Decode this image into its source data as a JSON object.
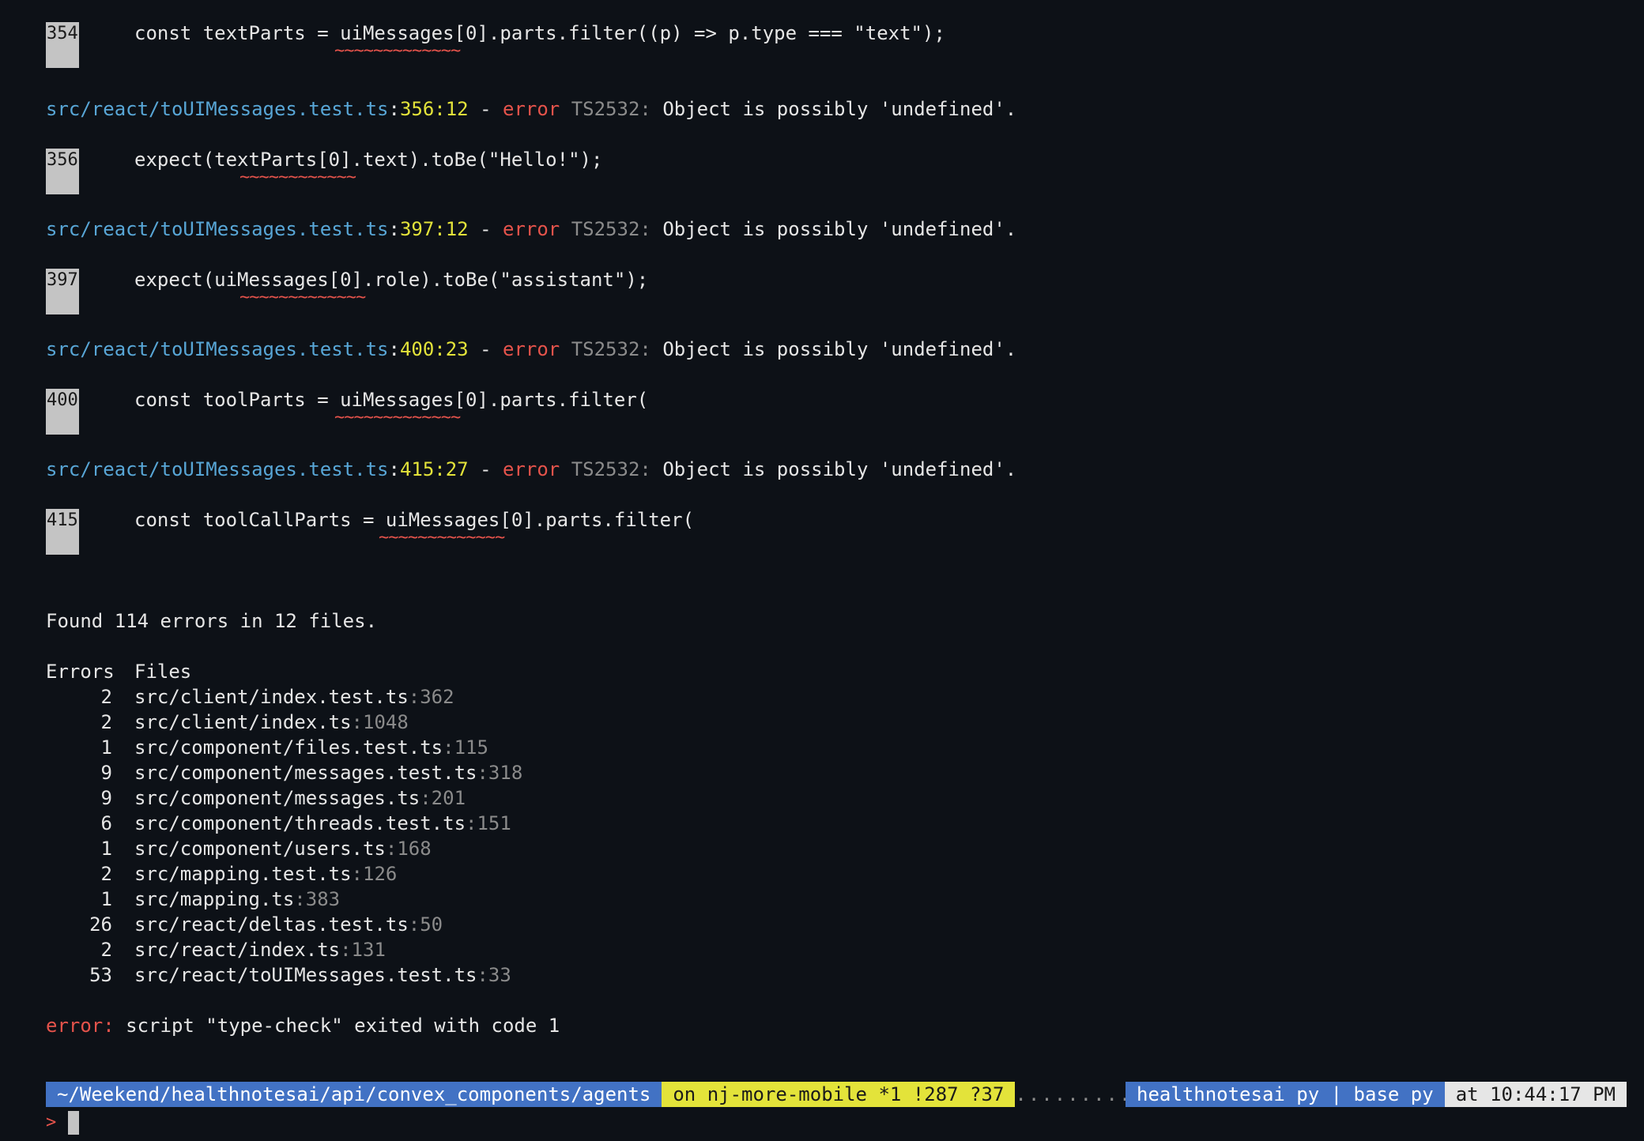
{
  "blocks": [
    {
      "lineno": "354",
      "code": "const textParts = uiMessages[0].parts.filter((p) => p.type === \"text\");",
      "squiggle": "~~~~~~~~~~~~~"
    },
    {
      "header": {
        "path": "src/react/toUIMessages.test.ts",
        "loc": "356:12",
        "dash": " - ",
        "level": "error",
        "code": "TS2532:",
        "message": "Object is possibly 'undefined'."
      },
      "lineno": "356",
      "code": "expect(textParts[0].text).toBe(\"Hello!\");",
      "squiggle": "~~~~~~~~~~~~"
    },
    {
      "header": {
        "path": "src/react/toUIMessages.test.ts",
        "loc": "397:12",
        "dash": " - ",
        "level": "error",
        "code": "TS2532:",
        "message": "Object is possibly 'undefined'."
      },
      "lineno": "397",
      "code": "expect(uiMessages[0].role).toBe(\"assistant\");",
      "squiggle": "~~~~~~~~~~~~~"
    },
    {
      "header": {
        "path": "src/react/toUIMessages.test.ts",
        "loc": "400:23",
        "dash": " - ",
        "level": "error",
        "code": "TS2532:",
        "message": "Object is possibly 'undefined'."
      },
      "lineno": "400",
      "code": "const toolParts = uiMessages[0].parts.filter(",
      "squiggle": "~~~~~~~~~~~~~"
    },
    {
      "header": {
        "path": "src/react/toUIMessages.test.ts",
        "loc": "415:27",
        "dash": " - ",
        "level": "error",
        "code": "TS2532:",
        "message": "Object is possibly 'undefined'."
      },
      "lineno": "415",
      "code": "const toolCallParts = uiMessages[0].parts.filter(",
      "squiggle": "~~~~~~~~~~~~~"
    }
  ],
  "summary": "Found 114 errors in 12 files.",
  "table": {
    "header_errors": "Errors",
    "header_files": "Files",
    "rows": [
      {
        "count": "2",
        "file": "src/client/index.test.ts",
        "line": ":362"
      },
      {
        "count": "2",
        "file": "src/client/index.ts",
        "line": ":1048"
      },
      {
        "count": "1",
        "file": "src/component/files.test.ts",
        "line": ":115"
      },
      {
        "count": "9",
        "file": "src/component/messages.test.ts",
        "line": ":318"
      },
      {
        "count": "9",
        "file": "src/component/messages.ts",
        "line": ":201"
      },
      {
        "count": "6",
        "file": "src/component/threads.test.ts",
        "line": ":151"
      },
      {
        "count": "1",
        "file": "src/component/users.ts",
        "line": ":168"
      },
      {
        "count": "2",
        "file": "src/mapping.test.ts",
        "line": ":126"
      },
      {
        "count": "1",
        "file": "src/mapping.ts",
        "line": ":383"
      },
      {
        "count": "26",
        "file": "src/react/deltas.test.ts",
        "line": ":50"
      },
      {
        "count": "2",
        "file": "src/react/index.ts",
        "line": ":131"
      },
      {
        "count": "53",
        "file": "src/react/toUIMessages.test.ts",
        "line": ":33"
      }
    ]
  },
  "final_error": {
    "label": "error:",
    "message": " script \"type-check\" exited with code 1"
  },
  "prompt": {
    "cwd": "~/Weekend/healthnotesai/api/convex_components/agents",
    "branch": "on nj-more-mobile *1 !287 ?37",
    "dots": "..............................................",
    "env": "healthnotesai py | base py",
    "time": "at 10:44:17 PM",
    "symbol": ">"
  },
  "colors": {
    "background": "#0d1117",
    "path": "#58a6d6",
    "location": "#e3e33a",
    "error": "#e5534b",
    "muted": "#8b8b8b",
    "segment_blue": "#4272c4",
    "segment_yellow": "#e3e33a"
  }
}
